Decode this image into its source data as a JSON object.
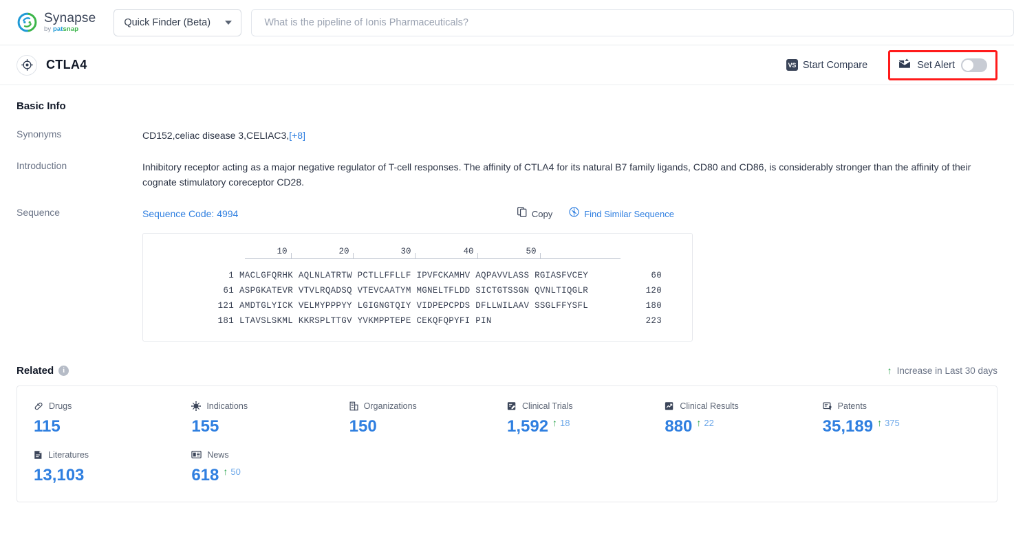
{
  "brand": {
    "name": "Synapse",
    "by": "by ",
    "pat": "pat",
    "snap": "snap"
  },
  "topbar": {
    "finder_label": "Quick Finder (Beta)",
    "search_placeholder": "What is the pipeline of Ionis Pharmaceuticals?",
    "search_value": ""
  },
  "entity": {
    "title": "CTLA4",
    "compare_label": "Start Compare",
    "compare_badge": "VS",
    "alert_label": "Set Alert",
    "alert_on": false
  },
  "basic_info": {
    "heading": "Basic Info",
    "synonyms_label": "Synonyms",
    "synonyms_value": "CD152,celiac disease 3,CELIAC3,",
    "synonyms_more": "[+8]",
    "introduction_label": "Introduction",
    "introduction_value": "Inhibitory receptor acting as a major negative regulator of T-cell responses. The affinity of CTLA4 for its natural B7 family ligands, CD80 and CD86, is considerably stronger than the affinity of their cognate stimulatory coreceptor CD28.",
    "sequence_label": "Sequence",
    "sequence_code": "Sequence Code: 4994",
    "copy_label": "Copy",
    "find_similar_label": "Find Similar Sequence"
  },
  "sequence": {
    "ruler": [
      "10",
      "20",
      "30",
      "40",
      "50"
    ],
    "lines": [
      {
        "start": "1",
        "chunks": "MACLGFQRHK AQLNLATRTW PCTLLFFLLF IPVFCKAMHV AQPAVVLASS RGIASFVCEY",
        "end": "60"
      },
      {
        "start": "61",
        "chunks": "ASPGKATEVR VTVLRQADSQ VTEVCAATYM MGNELTFLDD SICTGTSSGN QVNLTIQGLR",
        "end": "120"
      },
      {
        "start": "121",
        "chunks": "AMDTGLYICK VELMYPPPYY LGIGNGTQIY VIDPEPCPDS DFLLWILAAV SSGLFFYSFL",
        "end": "180"
      },
      {
        "start": "181",
        "chunks": "LTAVSLSKML KKRSPLTTGV YVKMPPTEPE CEKQFQPYFI PIN",
        "end": "223"
      }
    ]
  },
  "related": {
    "title": "Related",
    "info_glyph": "i",
    "legend_label": "Increase in Last 30 days",
    "legend_arrow": "↑",
    "metrics": [
      {
        "label": "Drugs",
        "icon": "pill-icon",
        "value": "115",
        "delta": ""
      },
      {
        "label": "Indications",
        "icon": "virus-icon",
        "value": "155",
        "delta": ""
      },
      {
        "label": "Organizations",
        "icon": "organization-icon",
        "value": "150",
        "delta": ""
      },
      {
        "label": "Clinical Trials",
        "icon": "clinical-trial-icon",
        "value": "1,592",
        "delta": "18"
      },
      {
        "label": "Clinical Results",
        "icon": "clinical-result-icon",
        "value": "880",
        "delta": "22"
      },
      {
        "label": "Patents",
        "icon": "patent-icon",
        "value": "35,189",
        "delta": "375"
      },
      {
        "label": "Literatures",
        "icon": "literature-icon",
        "value": "13,103",
        "delta": ""
      },
      {
        "label": "News",
        "icon": "news-icon",
        "value": "618",
        "delta": "50"
      }
    ]
  },
  "colors": {
    "accent_blue": "#2f7fe0",
    "green": "#2ea44f",
    "alert_red": "#ff1a1a",
    "dark_navy": "#3b4559"
  }
}
